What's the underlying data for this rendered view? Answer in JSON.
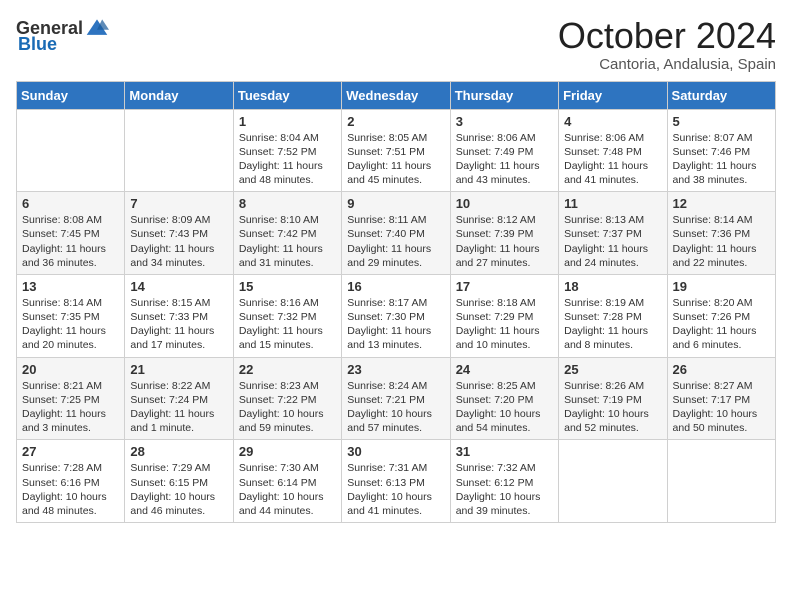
{
  "header": {
    "logo_general": "General",
    "logo_blue": "Blue",
    "month": "October 2024",
    "location": "Cantoria, Andalusia, Spain"
  },
  "days_of_week": [
    "Sunday",
    "Monday",
    "Tuesday",
    "Wednesday",
    "Thursday",
    "Friday",
    "Saturday"
  ],
  "weeks": [
    [
      {
        "day": "",
        "text": ""
      },
      {
        "day": "",
        "text": ""
      },
      {
        "day": "1",
        "text": "Sunrise: 8:04 AM\nSunset: 7:52 PM\nDaylight: 11 hours and 48 minutes."
      },
      {
        "day": "2",
        "text": "Sunrise: 8:05 AM\nSunset: 7:51 PM\nDaylight: 11 hours and 45 minutes."
      },
      {
        "day": "3",
        "text": "Sunrise: 8:06 AM\nSunset: 7:49 PM\nDaylight: 11 hours and 43 minutes."
      },
      {
        "day": "4",
        "text": "Sunrise: 8:06 AM\nSunset: 7:48 PM\nDaylight: 11 hours and 41 minutes."
      },
      {
        "day": "5",
        "text": "Sunrise: 8:07 AM\nSunset: 7:46 PM\nDaylight: 11 hours and 38 minutes."
      }
    ],
    [
      {
        "day": "6",
        "text": "Sunrise: 8:08 AM\nSunset: 7:45 PM\nDaylight: 11 hours and 36 minutes."
      },
      {
        "day": "7",
        "text": "Sunrise: 8:09 AM\nSunset: 7:43 PM\nDaylight: 11 hours and 34 minutes."
      },
      {
        "day": "8",
        "text": "Sunrise: 8:10 AM\nSunset: 7:42 PM\nDaylight: 11 hours and 31 minutes."
      },
      {
        "day": "9",
        "text": "Sunrise: 8:11 AM\nSunset: 7:40 PM\nDaylight: 11 hours and 29 minutes."
      },
      {
        "day": "10",
        "text": "Sunrise: 8:12 AM\nSunset: 7:39 PM\nDaylight: 11 hours and 27 minutes."
      },
      {
        "day": "11",
        "text": "Sunrise: 8:13 AM\nSunset: 7:37 PM\nDaylight: 11 hours and 24 minutes."
      },
      {
        "day": "12",
        "text": "Sunrise: 8:14 AM\nSunset: 7:36 PM\nDaylight: 11 hours and 22 minutes."
      }
    ],
    [
      {
        "day": "13",
        "text": "Sunrise: 8:14 AM\nSunset: 7:35 PM\nDaylight: 11 hours and 20 minutes."
      },
      {
        "day": "14",
        "text": "Sunrise: 8:15 AM\nSunset: 7:33 PM\nDaylight: 11 hours and 17 minutes."
      },
      {
        "day": "15",
        "text": "Sunrise: 8:16 AM\nSunset: 7:32 PM\nDaylight: 11 hours and 15 minutes."
      },
      {
        "day": "16",
        "text": "Sunrise: 8:17 AM\nSunset: 7:30 PM\nDaylight: 11 hours and 13 minutes."
      },
      {
        "day": "17",
        "text": "Sunrise: 8:18 AM\nSunset: 7:29 PM\nDaylight: 11 hours and 10 minutes."
      },
      {
        "day": "18",
        "text": "Sunrise: 8:19 AM\nSunset: 7:28 PM\nDaylight: 11 hours and 8 minutes."
      },
      {
        "day": "19",
        "text": "Sunrise: 8:20 AM\nSunset: 7:26 PM\nDaylight: 11 hours and 6 minutes."
      }
    ],
    [
      {
        "day": "20",
        "text": "Sunrise: 8:21 AM\nSunset: 7:25 PM\nDaylight: 11 hours and 3 minutes."
      },
      {
        "day": "21",
        "text": "Sunrise: 8:22 AM\nSunset: 7:24 PM\nDaylight: 11 hours and 1 minute."
      },
      {
        "day": "22",
        "text": "Sunrise: 8:23 AM\nSunset: 7:22 PM\nDaylight: 10 hours and 59 minutes."
      },
      {
        "day": "23",
        "text": "Sunrise: 8:24 AM\nSunset: 7:21 PM\nDaylight: 10 hours and 57 minutes."
      },
      {
        "day": "24",
        "text": "Sunrise: 8:25 AM\nSunset: 7:20 PM\nDaylight: 10 hours and 54 minutes."
      },
      {
        "day": "25",
        "text": "Sunrise: 8:26 AM\nSunset: 7:19 PM\nDaylight: 10 hours and 52 minutes."
      },
      {
        "day": "26",
        "text": "Sunrise: 8:27 AM\nSunset: 7:17 PM\nDaylight: 10 hours and 50 minutes."
      }
    ],
    [
      {
        "day": "27",
        "text": "Sunrise: 7:28 AM\nSunset: 6:16 PM\nDaylight: 10 hours and 48 minutes."
      },
      {
        "day": "28",
        "text": "Sunrise: 7:29 AM\nSunset: 6:15 PM\nDaylight: 10 hours and 46 minutes."
      },
      {
        "day": "29",
        "text": "Sunrise: 7:30 AM\nSunset: 6:14 PM\nDaylight: 10 hours and 44 minutes."
      },
      {
        "day": "30",
        "text": "Sunrise: 7:31 AM\nSunset: 6:13 PM\nDaylight: 10 hours and 41 minutes."
      },
      {
        "day": "31",
        "text": "Sunrise: 7:32 AM\nSunset: 6:12 PM\nDaylight: 10 hours and 39 minutes."
      },
      {
        "day": "",
        "text": ""
      },
      {
        "day": "",
        "text": ""
      }
    ]
  ]
}
